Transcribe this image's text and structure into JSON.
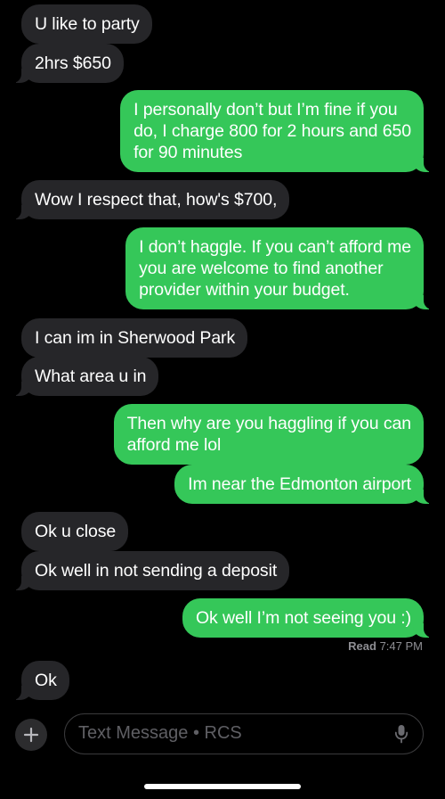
{
  "conversation": {
    "messages": [
      {
        "direction": "incoming",
        "text": "U like to party"
      },
      {
        "direction": "incoming",
        "text": "2hrs $650"
      },
      {
        "direction": "outgoing",
        "text": "I personally don’t but I’m fine if you\ndo, I charge 800 for 2 hours and 650\nfor 90 minutes"
      },
      {
        "direction": "incoming",
        "text": "Wow I respect that,  how's $700,"
      },
      {
        "direction": "outgoing",
        "text": "I don’t haggle. If you can’t afford me\nyou are welcome to find another\nprovider within your budget."
      },
      {
        "direction": "incoming",
        "text": "I can im in Sherwood Park"
      },
      {
        "direction": "incoming",
        "text": "What area u in"
      },
      {
        "direction": "outgoing",
        "text": "Then why are you haggling if you can\nafford me lol"
      },
      {
        "direction": "outgoing",
        "text": "Im near the Edmonton airport"
      },
      {
        "direction": "incoming",
        "text": "Ok u close"
      },
      {
        "direction": "incoming",
        "text": "Ok well in not sending a deposit"
      },
      {
        "direction": "outgoing",
        "text": "Ok well I’m not seeing you :)"
      },
      {
        "direction": "incoming",
        "text": "Ok"
      }
    ],
    "read_receipt": {
      "label": "Read",
      "time": "7:47 PM"
    }
  },
  "composer": {
    "placeholder": "Text Message • RCS",
    "value": "",
    "plus_icon": "plus-icon",
    "mic_icon": "microphone-icon"
  },
  "colors": {
    "background": "#000000",
    "incoming_bubble": "#262629",
    "outgoing_bubble": "#35c759",
    "secondary_text": "#8e8e93"
  }
}
